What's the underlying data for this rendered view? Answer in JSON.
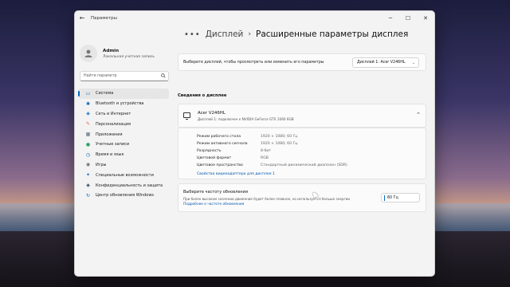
{
  "window": {
    "title": "Параметры",
    "controls": {
      "minimize": "─",
      "maximize": "☐",
      "close": "✕"
    },
    "back_glyph": "←"
  },
  "profile": {
    "name": "Admin",
    "subtitle": "Локальная учетная запись"
  },
  "search": {
    "placeholder": "Найти параметр"
  },
  "nav": [
    {
      "label": "Система",
      "icon": "system-icon",
      "color": "#0067c0",
      "active": true
    },
    {
      "label": "Bluetooth и устройства",
      "icon": "bluetooth-icon",
      "color": "#0067c0",
      "active": false
    },
    {
      "label": "Сеть и Интернет",
      "icon": "network-icon",
      "color": "#0067c0",
      "active": false
    },
    {
      "label": "Персонализация",
      "icon": "brush-icon",
      "color": "#d86a3d",
      "active": false
    },
    {
      "label": "Приложения",
      "icon": "apps-icon",
      "color": "#5b6b7a",
      "active": false
    },
    {
      "label": "Учетные записи",
      "icon": "accounts-icon",
      "color": "#2fa36b",
      "active": false
    },
    {
      "label": "Время и язык",
      "icon": "time-language-icon",
      "color": "#0067c0",
      "active": false
    },
    {
      "label": "Игры",
      "icon": "gaming-icon",
      "color": "#6b6b6b",
      "active": false
    },
    {
      "label": "Специальные возможности",
      "icon": "accessibility-icon",
      "color": "#1a6fc2",
      "active": false
    },
    {
      "label": "Конфиденциальность и защита",
      "icon": "shield-icon",
      "color": "#5b6b7a",
      "active": false
    },
    {
      "label": "Центр обновления Windows",
      "icon": "update-icon",
      "color": "#0067c0",
      "active": false
    }
  ],
  "breadcrumb": {
    "dots": "•••",
    "parent": "Дисплей",
    "separator": "›",
    "current": "Расширенные параметры дисплея"
  },
  "display_select": {
    "label": "Выберите дисплей, чтобы просмотреть или изменить его параметры",
    "value": "Дисплей 1: Acer V246HL",
    "chevron": "⌄"
  },
  "section_title": "Сведения о дисплее",
  "monitor": {
    "name": "Acer V246HL",
    "subtitle": "Дисплей 1: подключен к NVIDIA GeForce GTX 1060 6GB",
    "chevron": "⌃"
  },
  "info": [
    {
      "key": "Режим рабочего стола",
      "value": "1920 × 1080; 60 Гц"
    },
    {
      "key": "Режим активного сигнала",
      "value": "1920 × 1080; 60 Гц"
    },
    {
      "key": "Разрядность",
      "value": "8-бит"
    },
    {
      "key": "Цветовой формат",
      "value": "RGB"
    },
    {
      "key": "Цветовое пространство",
      "value": "Стандартный динамический диапазон (SDR)"
    }
  ],
  "adapter_link": "Свойства видеоадаптера для дисплея 1",
  "refresh": {
    "title": "Выберите частоту обновления",
    "description": "При более высоком значении движение будет более плавное, но используется больше энергии",
    "link": "Подробнее о частоте обновления",
    "value": "60 Гц"
  }
}
